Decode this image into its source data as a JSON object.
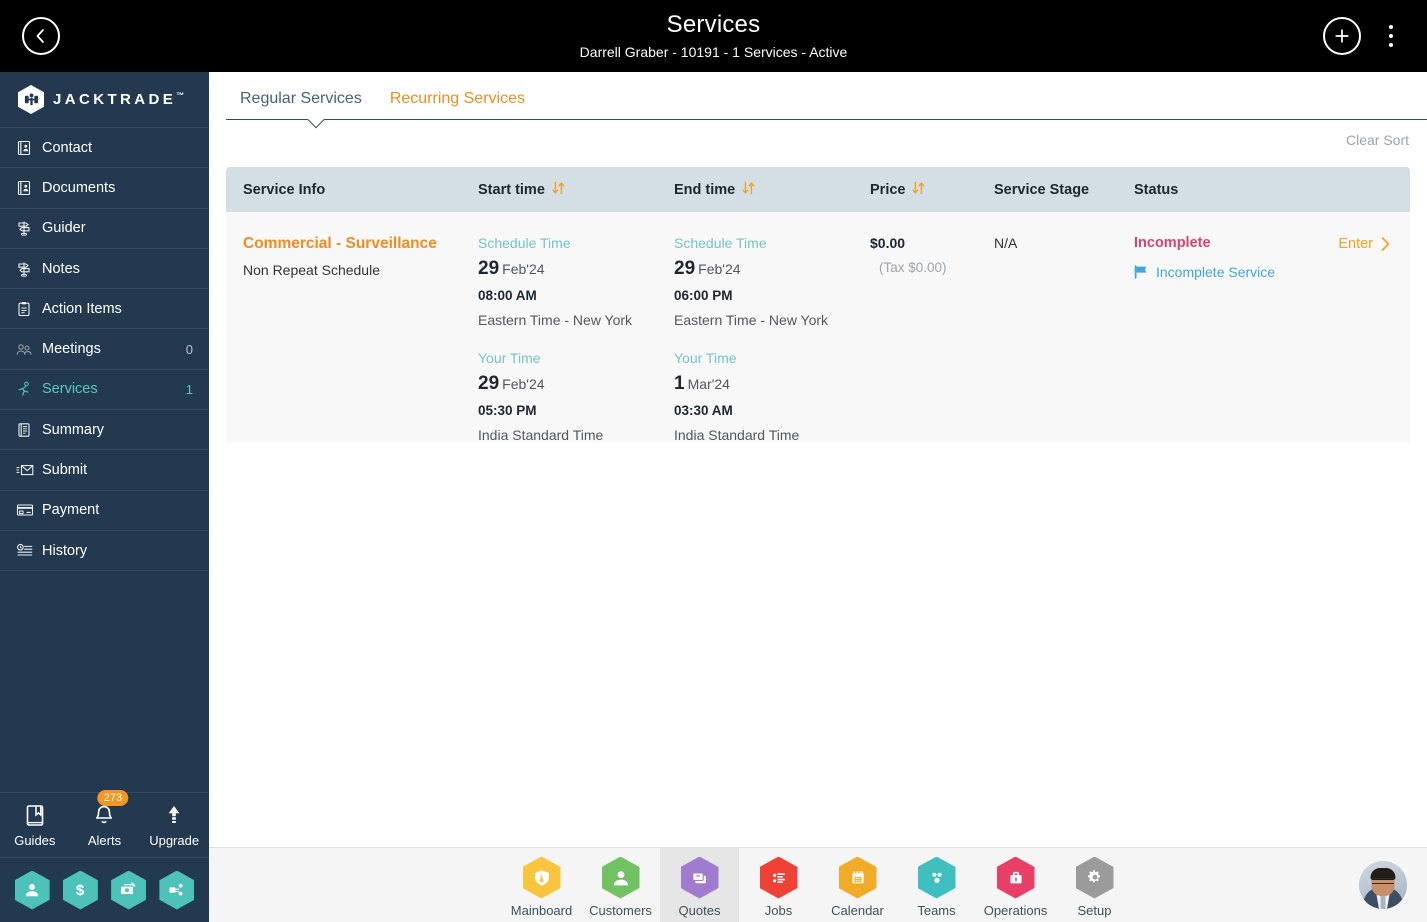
{
  "header": {
    "title": "Services",
    "subtitle": "Darrell Graber - 10191 - 1 Services - Active",
    "back_icon": "chevron-left-icon",
    "add_icon": "plus-icon",
    "menu_icon": "kebab-menu-icon"
  },
  "sidebar": {
    "brand": "JACKTRADE",
    "brand_tm": "™",
    "items": [
      {
        "label": "Contact",
        "icon": "contact-card-icon",
        "count": "",
        "active": false
      },
      {
        "label": "Documents",
        "icon": "document-icon",
        "count": "",
        "active": false
      },
      {
        "label": "Guider",
        "icon": "signpost-icon",
        "count": "",
        "active": false
      },
      {
        "label": "Notes",
        "icon": "signpost-icon",
        "count": "",
        "active": false
      },
      {
        "label": "Action Items",
        "icon": "clipboard-icon",
        "count": "",
        "active": false
      },
      {
        "label": "Meetings",
        "icon": "meetings-icon",
        "count": "0",
        "active": false
      },
      {
        "label": "Services",
        "icon": "services-icon",
        "count": "1",
        "active": true
      },
      {
        "label": "Summary",
        "icon": "book-icon",
        "count": "",
        "active": false
      },
      {
        "label": "Submit",
        "icon": "envelope-send-icon",
        "count": "",
        "active": false
      },
      {
        "label": "Payment",
        "icon": "payment-card-icon",
        "count": "",
        "active": false
      },
      {
        "label": "History",
        "icon": "history-icon",
        "count": "",
        "active": false
      }
    ],
    "tools": [
      {
        "label": "Guides",
        "icon": "book-bookmark-icon",
        "badge": ""
      },
      {
        "label": "Alerts",
        "icon": "bell-icon",
        "badge": "273"
      },
      {
        "label": "Upgrade",
        "icon": "up-arrow-icon",
        "badge": ""
      }
    ],
    "quick_hexes": [
      {
        "icon": "person-icon"
      },
      {
        "icon": "dollar-icon"
      },
      {
        "icon": "money-exchange-icon"
      },
      {
        "icon": "workflow-icon"
      }
    ],
    "hex_color": "#4cc2b8",
    "bg_color": "#23394f",
    "active_color": "#5cc6bd"
  },
  "main": {
    "tabs": [
      {
        "label": "Regular Services",
        "active": true
      },
      {
        "label": "Recurring Services",
        "active": false
      }
    ],
    "clear_sort": "Clear Sort",
    "table": {
      "columns": [
        {
          "label": "Service Info",
          "sortable": false
        },
        {
          "label": "Start time",
          "sortable": true
        },
        {
          "label": "End time",
          "sortable": true
        },
        {
          "label": "Price",
          "sortable": true
        },
        {
          "label": "Service Stage",
          "sortable": false
        },
        {
          "label": "Status",
          "sortable": false
        },
        {
          "label": "",
          "sortable": false
        }
      ],
      "rows": [
        {
          "service_title": "Commercial - Surveillance",
          "service_sub": "Non Repeat Schedule",
          "start": {
            "schedule_label": "Schedule Time",
            "schedule_day": "29",
            "schedule_month": "Feb'24",
            "schedule_time": "08:00 AM",
            "schedule_zone": "Eastern Time - New York",
            "your_label": "Your Time",
            "your_day": "29",
            "your_month": "Feb'24",
            "your_time": "05:30 PM",
            "your_zone": "India Standard Time"
          },
          "end": {
            "schedule_label": "Schedule Time",
            "schedule_day": "29",
            "schedule_month": "Feb'24",
            "schedule_time": "06:00 PM",
            "schedule_zone": "Eastern Time - New York",
            "your_label": "Your Time",
            "your_day": "1",
            "your_month": "Mar'24",
            "your_time": "03:30 AM",
            "your_zone": "India Standard Time"
          },
          "price": "$0.00",
          "price_tax": "(Tax $0.00)",
          "service_stage": "N/A",
          "status": "Incomplete",
          "status_link": "Incomplete Service",
          "status_link_icon": "flag-icon",
          "enter_label": "Enter",
          "enter_icon": "chevron-right-icon"
        }
      ]
    },
    "colors": {
      "header_bg": "#d3dee5",
      "row_bg": "#f8f8f8",
      "accent_orange": "#f08c1e",
      "status_red": "#d6446e",
      "link_blue": "#3ea6e0",
      "teal_label": "#73c4c8"
    }
  },
  "bottom_nav": {
    "items": [
      {
        "label": "Mainboard",
        "icon": "shield-icon",
        "color": "#fac43c",
        "selected": false
      },
      {
        "label": "Customers",
        "icon": "person-icon",
        "color": "#72c264",
        "selected": false
      },
      {
        "label": "Quotes",
        "icon": "quotes-icon",
        "color": "#a07bd0",
        "selected": true
      },
      {
        "label": "Jobs",
        "icon": "list-icon",
        "color": "#ef4136",
        "selected": false
      },
      {
        "label": "Calendar",
        "icon": "calendar-icon",
        "color": "#f2ab28",
        "selected": false
      },
      {
        "label": "Teams",
        "icon": "teams-icon",
        "color": "#3fbfbf",
        "selected": false
      },
      {
        "label": "Operations",
        "icon": "briefcase-icon",
        "color": "#e83f66",
        "selected": false
      },
      {
        "label": "Setup",
        "icon": "gear-icon",
        "color": "#9b9b9b",
        "selected": false
      }
    ],
    "avatar": "user-avatar"
  }
}
